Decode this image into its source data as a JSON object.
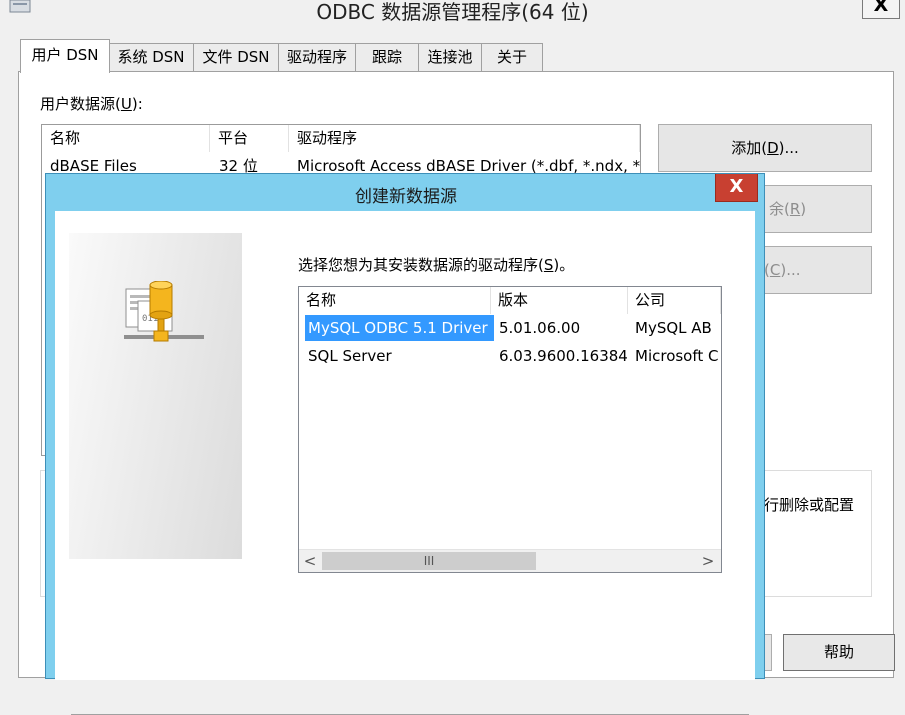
{
  "window": {
    "title": "ODBC 数据源管理程序(64 位)",
    "close_glyph": "X"
  },
  "tabs": [
    {
      "label": "用户 DSN",
      "active": true
    },
    {
      "label": "系统 DSN"
    },
    {
      "label": "文件 DSN"
    },
    {
      "label": "驱动程序"
    },
    {
      "label": "跟踪"
    },
    {
      "label": "连接池"
    },
    {
      "label": "关于"
    }
  ],
  "user_dsn": {
    "label": "用户数据源(U):",
    "columns": [
      "名称",
      "平台",
      "驱动程序"
    ],
    "rows": [
      {
        "name": "dBASE Files",
        "platform": "32 位",
        "driver": "Microsoft Access dBASE Driver (*.dbf, *.ndx, *"
      }
    ],
    "buttons": {
      "add": "添加(D)...",
      "remove_fragment": "余(R)",
      "configure_fragment": "(C)..."
    },
    "info_fragment": "行删除或配置",
    "help": "帮助"
  },
  "dialog": {
    "title": "创建新数据源",
    "close_glyph": "X",
    "prompt": "选择您想为其安装数据源的驱动程序(S)。",
    "columns": [
      "名称",
      "版本",
      "公司"
    ],
    "drivers": [
      {
        "name": "MySQL ODBC 5.1 Driver",
        "version": "5.01.06.00",
        "company": "MySQL AB",
        "selected": true
      },
      {
        "name": "SQL Server",
        "version": "6.03.9600.16384",
        "company": "Microsoft C",
        "selected": false
      }
    ],
    "scroll": {
      "left": "<",
      "right": ">",
      "thumb": "III"
    }
  },
  "icons": {
    "app": "app-icon",
    "datasource": "database-icon"
  },
  "colors": {
    "dialog_frame": "#7fcfee",
    "close_button": "#c84031",
    "selection": "#3399ff"
  }
}
